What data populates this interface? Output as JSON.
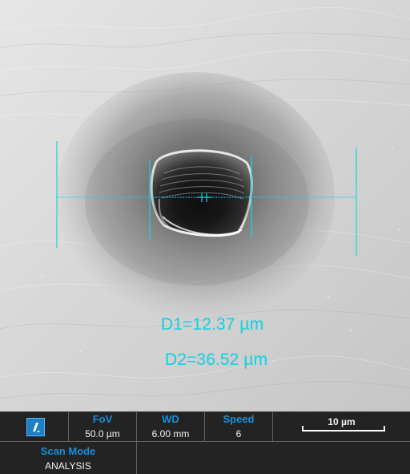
{
  "image": {
    "measurements": {
      "d1_label": "D1=12.37 µm",
      "d2_label": "D2=36.52 µm"
    },
    "overlay_color": "#12d7e6"
  },
  "status_bar": {
    "fov": {
      "label": "FoV",
      "value": "50.0 µm"
    },
    "wd": {
      "label": "WD",
      "value": "6.00 mm"
    },
    "speed": {
      "label": "Speed",
      "value": "6"
    },
    "scale_bar": {
      "label": "10 µm"
    },
    "scan_mode": {
      "label": "Scan Mode",
      "value": "ANALYSIS"
    },
    "label_color": "#188fd8",
    "background_color": "#232323"
  },
  "icons": {
    "logo": "phenom-logo-icon"
  }
}
